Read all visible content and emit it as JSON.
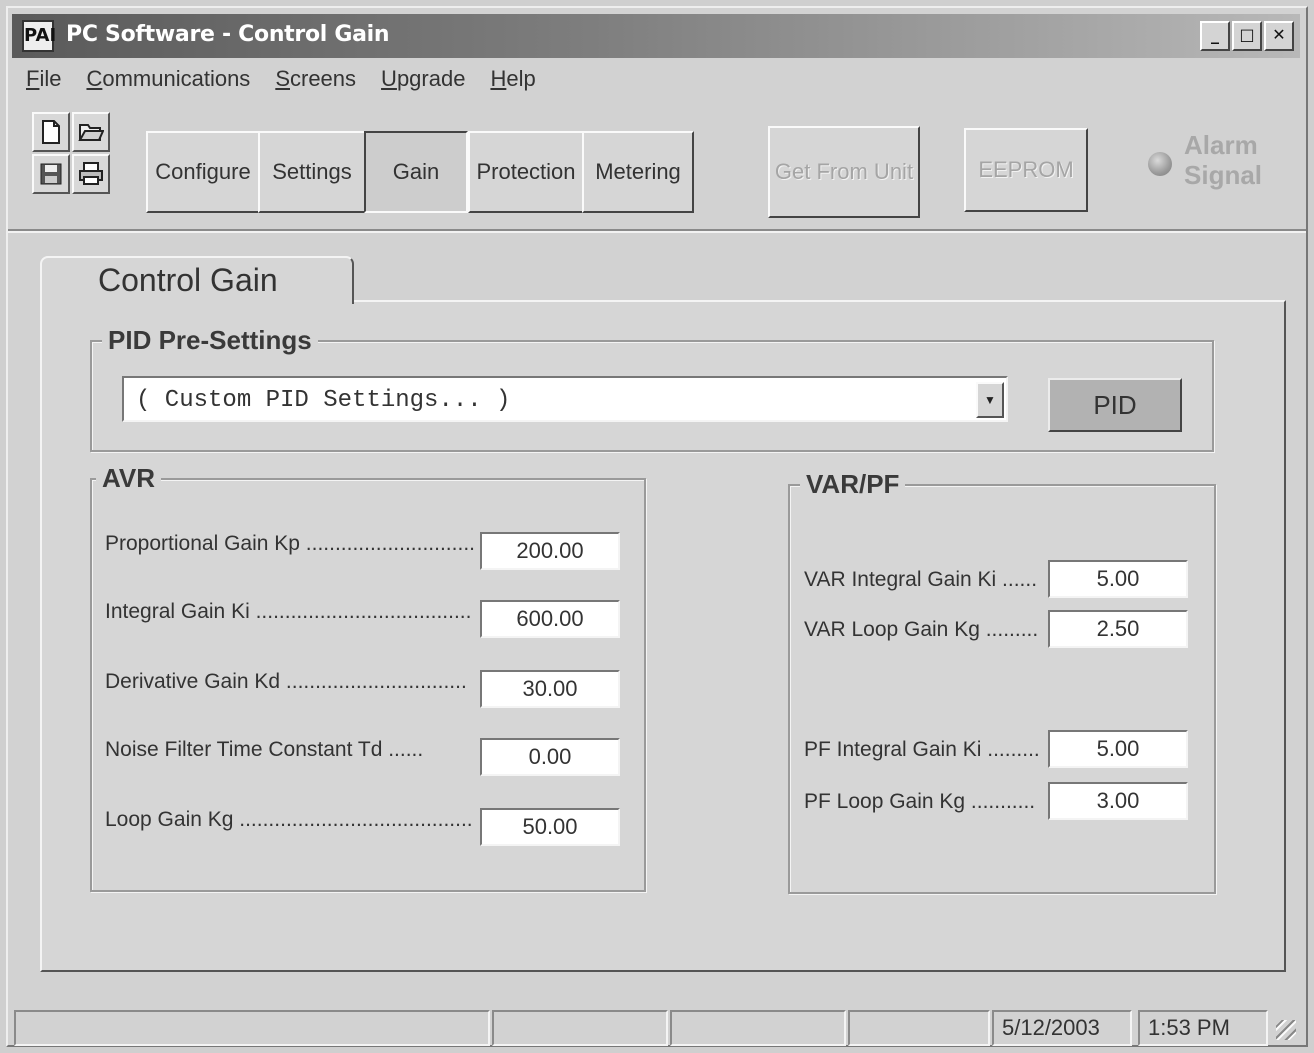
{
  "window": {
    "title": "PC Software - Control Gain",
    "logo_text": "PAI"
  },
  "menu": [
    {
      "prefix": "",
      "accel": "F",
      "rest": "ile"
    },
    {
      "prefix": "",
      "accel": "C",
      "rest": "ommunications"
    },
    {
      "prefix": "",
      "accel": "S",
      "rest": "creens"
    },
    {
      "prefix": "",
      "accel": "U",
      "rest": "pgrade"
    },
    {
      "prefix": "",
      "accel": "H",
      "rest": "elp"
    }
  ],
  "toolbar": {
    "configure": "Configure",
    "settings": "Settings",
    "gain": "Gain",
    "protection": "Protection",
    "metering": "Metering",
    "get_from_unit": "Get From Unit",
    "eeprom": "EEPROM",
    "alarm_line1": "Alarm",
    "alarm_line2": "Signal"
  },
  "tab": {
    "label": "Control Gain"
  },
  "pid": {
    "title": "PID Pre-Settings",
    "selected": "( Custom PID Settings... )",
    "button": "PID"
  },
  "avr": {
    "title": "AVR",
    "params": [
      {
        "label": "Proportional Gain Kp ..............................",
        "value": "200.00"
      },
      {
        "label": "Integral Gain Ki .....................................",
        "value": "600.00"
      },
      {
        "label": "Derivative Gain Kd ...............................",
        "value": "30.00"
      },
      {
        "label": "Noise Filter Time Constant Td ......",
        "value": "0.00"
      },
      {
        "label": "Loop Gain Kg ........................................",
        "value": "50.00"
      }
    ]
  },
  "varpf": {
    "title": "VAR/PF",
    "params": [
      {
        "label": "VAR Integral Gain Ki ......",
        "value": "5.00"
      },
      {
        "label": "VAR Loop Gain Kg .........",
        "value": "2.50"
      },
      {
        "label": "PF Integral Gain Ki .........",
        "value": "5.00"
      },
      {
        "label": "PF Loop Gain Kg ...........",
        "value": "3.00"
      }
    ]
  },
  "status": {
    "date": "5/12/2003",
    "time": "1:53 PM"
  }
}
